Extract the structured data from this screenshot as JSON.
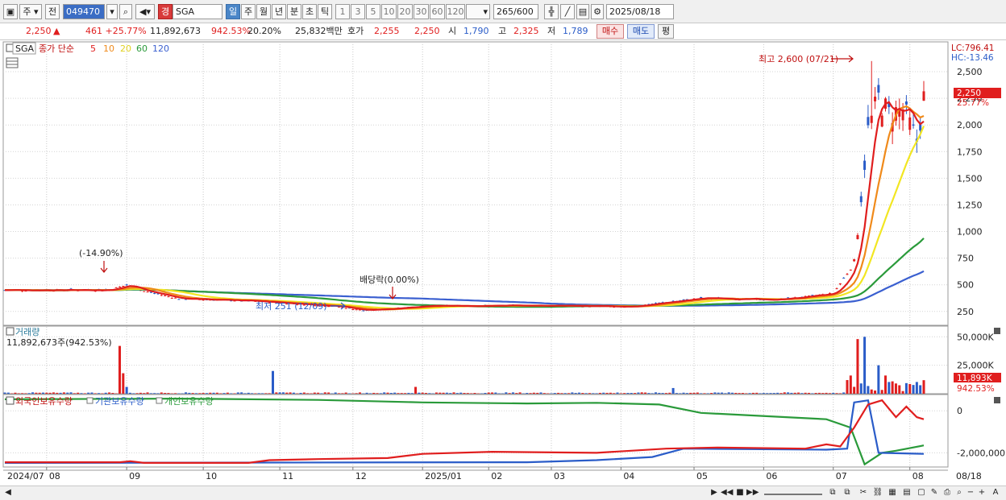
{
  "toolbar": {
    "market_label": "주",
    "prev_label": "전",
    "code": "049470",
    "badge": "경",
    "stock_name": "SGA",
    "periods": [
      "일",
      "주",
      "월",
      "년",
      "분",
      "초",
      "틱"
    ],
    "active_period": "일",
    "intervals": [
      "1",
      "3",
      "5",
      "10",
      "20",
      "30",
      "60",
      "120"
    ],
    "count": "265",
    "count_max": "/600",
    "date": "2025/08/18"
  },
  "quote": {
    "price": "2,250",
    "change": "461 +25.77%",
    "volume": "11,892,673",
    "volume_ratio": "942.53%",
    "turnover": "20.20%",
    "amount": "25,832백만",
    "hoga_label": "호가",
    "hoga_bid": "2,255",
    "hoga_ask": "2,250",
    "open_label": "시",
    "open": "1,790",
    "high_label": "고",
    "high": "2,325",
    "low_label": "저",
    "low": "1,789",
    "buy_label": "매수",
    "sell_label": "매도",
    "flat_label": "평"
  },
  "colors": {
    "up": "#e01e1e",
    "down": "#2a5cc8",
    "ma5": "#e01e1e",
    "ma10": "#f08a1a",
    "ma20": "#f2e622",
    "ma60": "#2a9a3a",
    "ma120": "#3a5fd0"
  },
  "price_panel": {
    "symbol": "SGA",
    "legend_prefix": "종가 단순",
    "ma_periods": [
      "5",
      "10",
      "20",
      "60",
      "120"
    ],
    "lc_label": "LC:796.41",
    "hc_label": "HC:-13.46",
    "y_ticks": [
      "2,500",
      "2,250",
      "2,000",
      "1,750",
      "1,500",
      "1,250",
      "1,000",
      "750",
      "500",
      "250"
    ],
    "current_price": "2,250",
    "current_change": "25.77%",
    "annotations": {
      "high": "최고 2,600 (07/21)",
      "low": "최저 251 (12/09)",
      "rights": "(-14.90%)",
      "dividend": "배당락(0.00%)"
    }
  },
  "volume_panel": {
    "title": "거래량",
    "subtitle": "11,892,673주(942.53%)",
    "y_ticks": [
      "50,000K",
      "25,000K"
    ],
    "current": "11,893K",
    "current_ratio": "942.53%"
  },
  "holding_panel": {
    "legends": [
      "외국인보유수량",
      "기관보유수량",
      "개인보유수량"
    ],
    "y_ticks": [
      "0",
      "-2,000,000"
    ]
  },
  "x_axis": {
    "labels": [
      "2024/07",
      "08",
      "09",
      "10",
      "11",
      "12",
      "2025/01",
      "02",
      "03",
      "04",
      "05",
      "06",
      "07",
      "08",
      "08/18"
    ]
  },
  "chart_data": {
    "type": "candlestick",
    "price": {
      "dates": [
        "2024/07",
        "2024/08",
        "2024/08/20",
        "2024/09",
        "2024/10",
        "2024/11",
        "2024/12/09",
        "2025/01",
        "2025/02",
        "2025/03",
        "2025/04",
        "2025/05",
        "2025/06",
        "2025/07/01",
        "2025/07/21",
        "2025/08",
        "2025/08/18"
      ],
      "close": [
        450,
        450,
        480,
        370,
        330,
        290,
        251,
        300,
        310,
        300,
        290,
        380,
        360,
        420,
        2600,
        2150,
        2250
      ],
      "high_max": 2600,
      "low_min": 251
    },
    "volume_k": {
      "spikes": [
        {
          "date": "2024/08/20",
          "value": 42000
        },
        {
          "date": "2024/11",
          "value": 20000
        },
        {
          "date": "2025/07",
          "value": 48000
        },
        {
          "date": "2025/08/18",
          "value": 11893
        }
      ]
    },
    "ylim_price": [
      120,
      2780
    ],
    "ylim_volume_k": [
      0,
      58000
    ]
  }
}
